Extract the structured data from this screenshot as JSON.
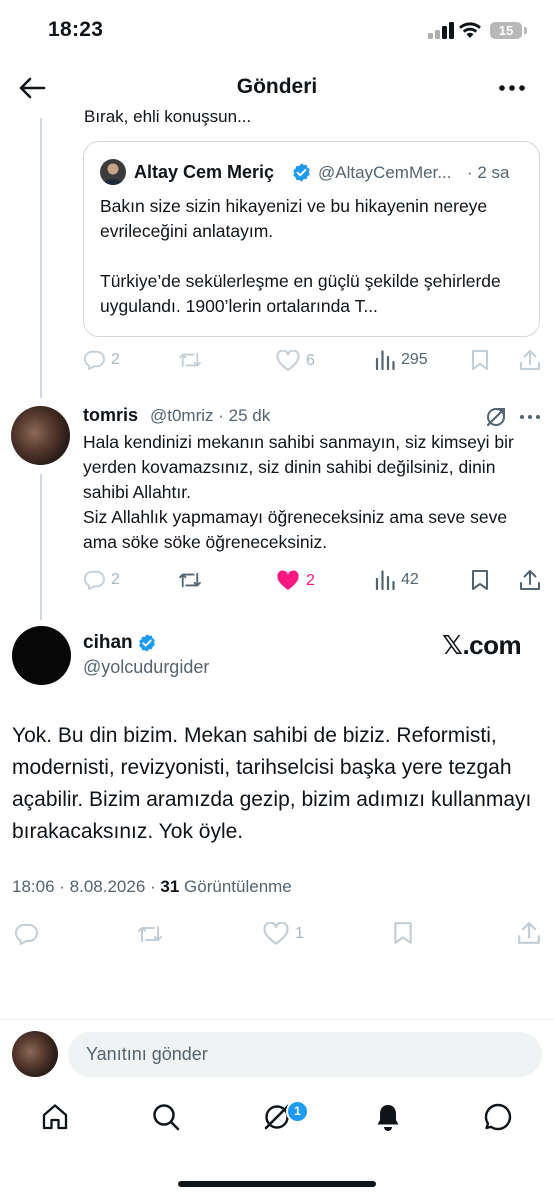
{
  "status_bar": {
    "time": "18:23",
    "battery": "15"
  },
  "header": {
    "title": "Gönderi"
  },
  "clipped_text": "Bırak, ehli konuşsun...",
  "quote": {
    "name": "Altay Cem Meriç",
    "handle": "@AltayCemMer...",
    "time": "· 2 sa",
    "body_p1": "Bakın size sizin hikayenizi ve bu hikayenin nereye evrileceğini anlatayım.",
    "body_p2": "Türkiye’de sekülerleşme en güçlü şekilde şehirlerde uygulandı. 1900’lerin ortalarında T..."
  },
  "parent_actions": {
    "replies": "2",
    "retweets": "",
    "likes": "6",
    "views": "295"
  },
  "reply": {
    "name": "tomris",
    "handle_time": "@t0mriz · 25 dk",
    "body": "Hala kendinizi mekanın sahibi sanmayın, siz kimseyi bir yerden kovamazsınız, siz dinin sahibi değilsiniz, dinin sahibi Allahtır.\nSiz Allahlık yapmamayı öğreneceksiniz ama seve seve ama söke söke öğreneceksiniz.",
    "actions": {
      "replies": "2",
      "retweets": "",
      "likes": "2",
      "views": "42"
    }
  },
  "main_tweet": {
    "name": "cihan",
    "handle": "@yolcudurgider",
    "brand": "𝕏.com",
    "body": "Yok. Bu din bizim. Mekan sahibi de biziz. Reformisti, modernisti, revizyonisti, tarihselcisi başka yere tezgah açabilir. Bizim aramızda gezip, bizim adımızı kullanmayı bırakacaksınız. Yok öyle.",
    "timestamp": "18:06 · 8.08.2026 · ",
    "views_count": "31",
    "views_label": " Görüntülenme",
    "actions": {
      "replies": "",
      "retweets": "",
      "likes": "1"
    }
  },
  "composer": {
    "placeholder": "Yanıtını gönder"
  },
  "tab_bar": {
    "notification_badge": "1"
  },
  "colors": {
    "accent": "#1d9bf0",
    "like": "#f91880",
    "muted": "#536471",
    "text": "#0f1419"
  }
}
